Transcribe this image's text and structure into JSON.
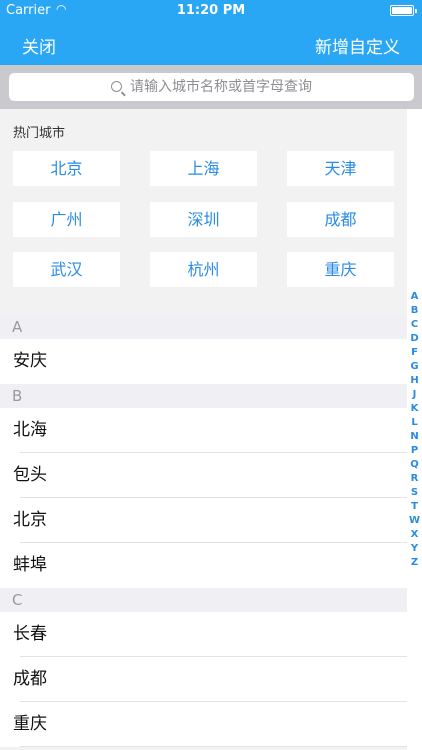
{
  "status": {
    "carrier": "Carrier",
    "time": "11:20 PM"
  },
  "nav": {
    "close": "关闭",
    "add_custom": "新增自定义"
  },
  "search": {
    "placeholder": "请输入城市名称或首字母查询"
  },
  "hot": {
    "title": "热门城市",
    "cities": [
      "北京",
      "上海",
      "天津",
      "广州",
      "深圳",
      "成都",
      "武汉",
      "杭州",
      "重庆"
    ]
  },
  "sections": [
    {
      "letter": "A",
      "cities": [
        "安庆"
      ]
    },
    {
      "letter": "B",
      "cities": [
        "北海",
        "包头",
        "北京",
        "蚌埠"
      ]
    },
    {
      "letter": "C",
      "cities": [
        "长春",
        "成都",
        "重庆"
      ]
    }
  ],
  "index_letters": [
    "A",
    "B",
    "C",
    "D",
    "F",
    "G",
    "H",
    "J",
    "K",
    "L",
    "N",
    "P",
    "Q",
    "R",
    "S",
    "T",
    "W",
    "X",
    "Y",
    "Z"
  ],
  "colors": {
    "bar": "#2aa7f4",
    "accent": "#2a8be6"
  }
}
